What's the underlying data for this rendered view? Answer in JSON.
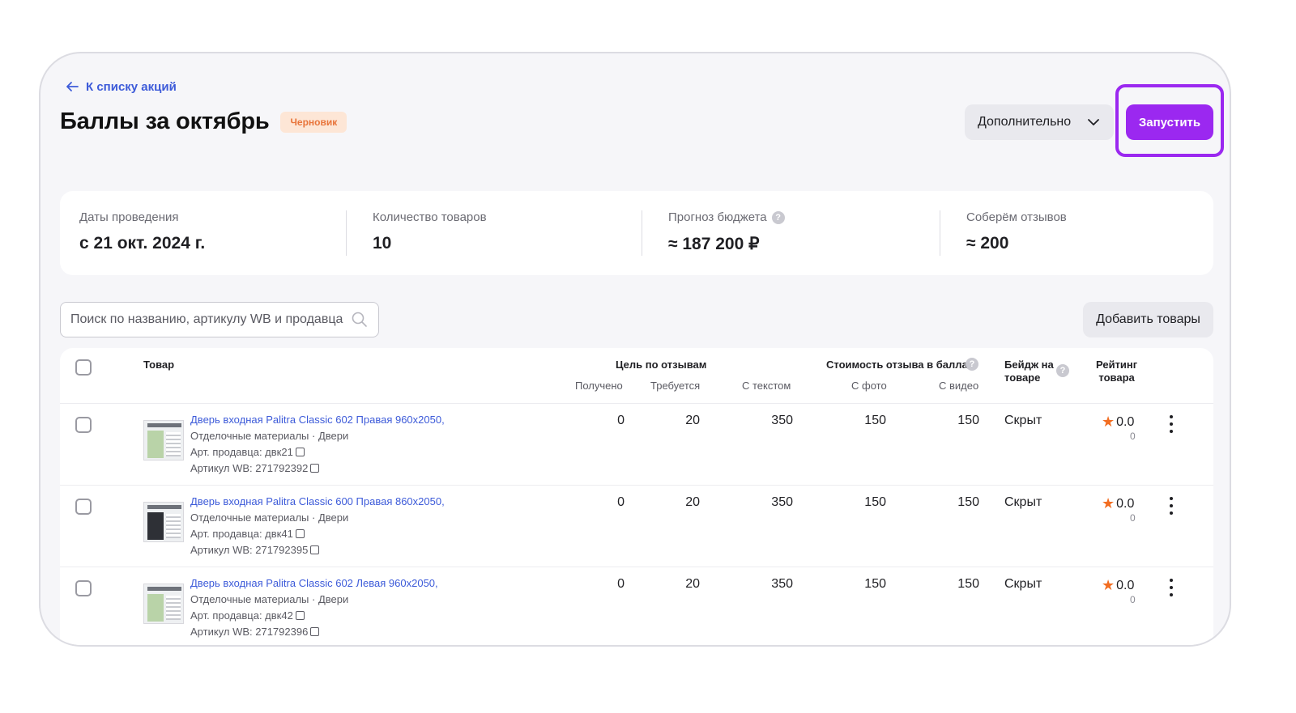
{
  "header": {
    "back_label": "К списку акций",
    "title": "Баллы за октябрь",
    "status": "Черновик",
    "more_label": "Дополнительно",
    "launch_label": "Запустить"
  },
  "stats": [
    {
      "label": "Даты проведения",
      "value": "с 21 окт. 2024 г."
    },
    {
      "label": "Количество товаров",
      "value": "10"
    },
    {
      "label": "Прогноз бюджета",
      "value": "≈ 187 200 ₽"
    },
    {
      "label": "Соберём отзывов",
      "value": "≈ 200"
    }
  ],
  "search": {
    "placeholder": "Поиск по названию, артикулу WB и продавца"
  },
  "add_label": "Добавить товары",
  "table": {
    "col_product": "Товар",
    "col_goal": "Цель по отзывам",
    "col_received": "Получено",
    "col_required": "Требуется",
    "col_cost": "Стоимость отзыва в баллах",
    "col_text": "С текстом",
    "col_photo": "С фото",
    "col_video": "С видео",
    "col_badge_1": "Бейдж на",
    "col_badge_2": "товаре",
    "col_rating_1": "Рейтинг",
    "col_rating_2": "товара",
    "rows": [
      {
        "name": "Дверь входная Palitra Classic 602 Правая 960х2050,",
        "category": "Отделочные материалы · Двери",
        "seller_art": "Арт. продавца: двк21",
        "wb_art": "Артикул WB: 271792392",
        "received": "0",
        "required": "20",
        "text": "350",
        "photo": "150",
        "video": "150",
        "badge": "Скрыт",
        "rating": "0.0",
        "rating_count": "0",
        "door_color": "#b9d3a8"
      },
      {
        "name": "Дверь входная Palitra Classic 600 Правая 860х2050,",
        "category": "Отделочные материалы · Двери",
        "seller_art": "Арт. продавца: двк41",
        "wb_art": "Артикул WB: 271792395",
        "received": "0",
        "required": "20",
        "text": "350",
        "photo": "150",
        "video": "150",
        "badge": "Скрыт",
        "rating": "0.0",
        "rating_count": "0",
        "door_color": "#2e3036"
      },
      {
        "name": "Дверь входная Palitra Classic 602 Левая 960х2050,",
        "category": "Отделочные материалы · Двери",
        "seller_art": "Арт. продавца: двк42",
        "wb_art": "Артикул WB: 271792396",
        "received": "0",
        "required": "20",
        "text": "350",
        "photo": "150",
        "video": "150",
        "badge": "Скрыт",
        "rating": "0.0",
        "rating_count": "0",
        "door_color": "#b9d3a8"
      }
    ]
  },
  "colors": {
    "accent": "#9b28f0",
    "link": "#3d5bd9",
    "badge_bg": "#fde6d6",
    "badge_text": "#e8743a",
    "star": "#f26d21"
  }
}
